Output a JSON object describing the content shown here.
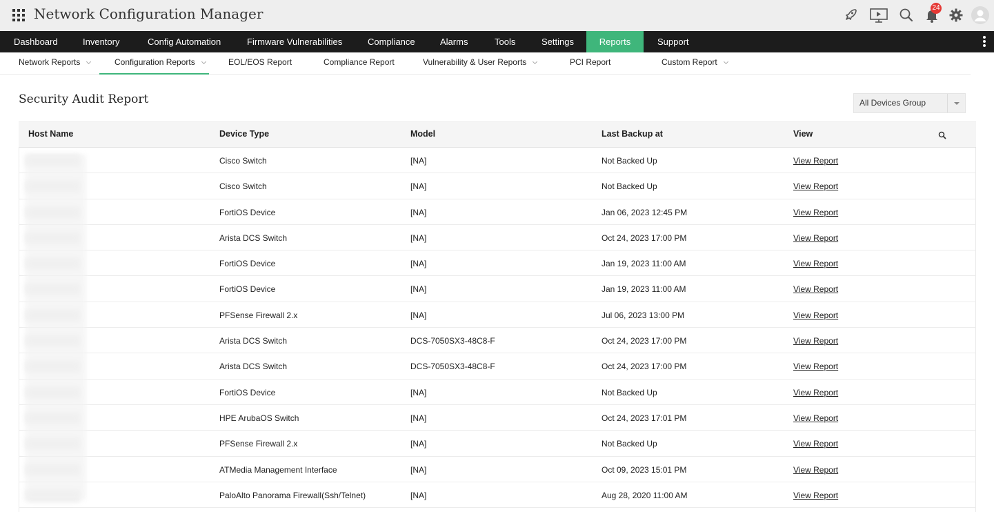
{
  "header": {
    "title": "Network Configuration Manager",
    "notification_count": "24",
    "icons": [
      "apps-grid-icon",
      "rocket-icon",
      "presentation-icon",
      "search-icon",
      "bell-icon",
      "gear-icon",
      "user-avatar-icon"
    ]
  },
  "main_nav": {
    "items": [
      {
        "label": "Dashboard"
      },
      {
        "label": "Inventory"
      },
      {
        "label": "Config Automation"
      },
      {
        "label": "Firmware Vulnerabilities"
      },
      {
        "label": "Compliance"
      },
      {
        "label": "Alarms"
      },
      {
        "label": "Tools"
      },
      {
        "label": "Settings"
      },
      {
        "label": "Reports"
      },
      {
        "label": "Support"
      }
    ],
    "active": "Reports",
    "accent_color": "#3fb67b"
  },
  "sub_nav": {
    "items": [
      {
        "label": "Network Reports"
      },
      {
        "label": "Configuration Reports"
      },
      {
        "label": "EOL/EOS Report"
      },
      {
        "label": "Compliance Report"
      },
      {
        "label": "Vulnerability & User Reports"
      },
      {
        "label": "PCI Report"
      },
      {
        "label": "Custom Report"
      }
    ],
    "active": "Configuration Reports"
  },
  "page": {
    "title": "Security Audit Report",
    "group_select": {
      "value": "All Devices Group"
    }
  },
  "table": {
    "columns": [
      "Host Name",
      "Device Type",
      "Model",
      "Last Backup at",
      "View"
    ],
    "rows": [
      {
        "device_type": "Cisco Switch",
        "model": "[NA]",
        "last_backup": "Not Backed Up",
        "view": "View Report"
      },
      {
        "device_type": "Cisco Switch",
        "model": "[NA]",
        "last_backup": "Not Backed Up",
        "view": "View Report"
      },
      {
        "device_type": "FortiOS Device",
        "model": "[NA]",
        "last_backup": "Jan 06, 2023 12:45 PM",
        "view": "View Report"
      },
      {
        "device_type": "Arista DCS Switch",
        "model": "[NA]",
        "last_backup": "Oct 24, 2023 17:00 PM",
        "view": "View Report"
      },
      {
        "device_type": "FortiOS Device",
        "model": "[NA]",
        "last_backup": "Jan 19, 2023 11:00 AM",
        "view": "View Report"
      },
      {
        "device_type": "FortiOS Device",
        "model": "[NA]",
        "last_backup": "Jan 19, 2023 11:00 AM",
        "view": "View Report"
      },
      {
        "device_type": "PFSense Firewall 2.x",
        "model": "[NA]",
        "last_backup": "Jul 06, 2023 13:00 PM",
        "view": "View Report"
      },
      {
        "device_type": "Arista DCS Switch",
        "model": "DCS-7050SX3-48C8-F",
        "last_backup": "Oct 24, 2023 17:00 PM",
        "view": "View Report"
      },
      {
        "device_type": "Arista DCS Switch",
        "model": "DCS-7050SX3-48C8-F",
        "last_backup": "Oct 24, 2023 17:00 PM",
        "view": "View Report"
      },
      {
        "device_type": "FortiOS Device",
        "model": "[NA]",
        "last_backup": "Not Backed Up",
        "view": "View Report"
      },
      {
        "device_type": "HPE ArubaOS Switch",
        "model": "[NA]",
        "last_backup": "Oct 24, 2023 17:01 PM",
        "view": "View Report"
      },
      {
        "device_type": "PFSense Firewall 2.x",
        "model": "[NA]",
        "last_backup": "Not Backed Up",
        "view": "View Report"
      },
      {
        "device_type": "ATMedia Management Interface",
        "model": "[NA]",
        "last_backup": "Oct 09, 2023 15:01 PM",
        "view": "View Report"
      },
      {
        "device_type": "PaloAlto Panorama Firewall(Ssh/Telnet)",
        "model": "[NA]",
        "last_backup": "Aug 28, 2020 11:00 AM",
        "view": "View Report"
      }
    ]
  }
}
